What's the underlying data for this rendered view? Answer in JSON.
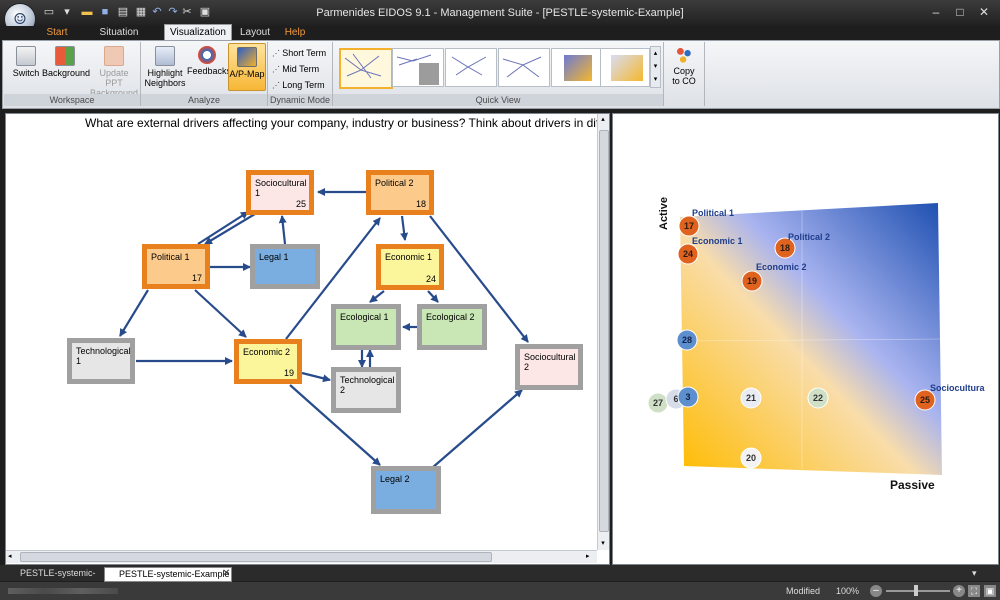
{
  "window": {
    "title": "Parmenides EIDOS 9.1 - Management Suite - [PESTLE-systemic-Example]"
  },
  "tabs": [
    {
      "label": "Start",
      "accent": "orange"
    },
    {
      "label": "Situation Analysis"
    },
    {
      "label": "Visualization",
      "active": true
    },
    {
      "label": "Layout"
    },
    {
      "label": "Help",
      "accent": "orange"
    }
  ],
  "ribbon": {
    "workspace": {
      "label": "Workspace",
      "switch": "Switch",
      "background": "Background",
      "update_ppt_line1": "Update PPT",
      "update_ppt_line2": "Background"
    },
    "analyze": {
      "label": "Analyze",
      "highlight_line1": "Highlight",
      "highlight_line2": "Neighbors",
      "feedbacks": "Feedbacks",
      "ap_map": "A/P-Map"
    },
    "dynamic": {
      "label": "Dynamic Mode",
      "short": "Short Term",
      "mid": "Mid Term",
      "long": "Long Term"
    },
    "quick_view": {
      "label": "Quick View"
    },
    "copy": {
      "line1": "Copy",
      "line2": "to CO"
    }
  },
  "diagram": {
    "question": "What are external drivers affecting your company, industry or business? Think about drivers in different categories",
    "nodes": [
      {
        "label": "Sociocultural 1",
        "num": "25"
      },
      {
        "label": "Political 2",
        "num": "18"
      },
      {
        "label": "Political 1",
        "num": "17"
      },
      {
        "label": "Legal 1",
        "num": ""
      },
      {
        "label": "Economic 1",
        "num": "24"
      },
      {
        "label": "Ecological 1",
        "num": ""
      },
      {
        "label": "Ecological 2",
        "num": ""
      },
      {
        "label": "Technological 1",
        "num": ""
      },
      {
        "label": "Economic 2",
        "num": "19"
      },
      {
        "label": "Technological 2",
        "num": ""
      },
      {
        "label": "Sociocultural 2",
        "num": ""
      },
      {
        "label": "Legal 2",
        "num": ""
      }
    ]
  },
  "ap_map": {
    "axis_active": "Active",
    "axis_passive": "Passive",
    "point_labels": [
      "Political 1",
      "Economic 1",
      "Political 2",
      "Economic 2",
      "Sociocultura"
    ],
    "points": [
      "17",
      "24",
      "18",
      "19",
      "28",
      "27",
      "6",
      "3",
      "21",
      "22",
      "25",
      "20"
    ]
  },
  "doc_tabs": [
    "PESTLE-systemic-Start",
    "PESTLE-systemic-Example"
  ],
  "status": {
    "modified": "Modified",
    "zoom": "100%"
  }
}
